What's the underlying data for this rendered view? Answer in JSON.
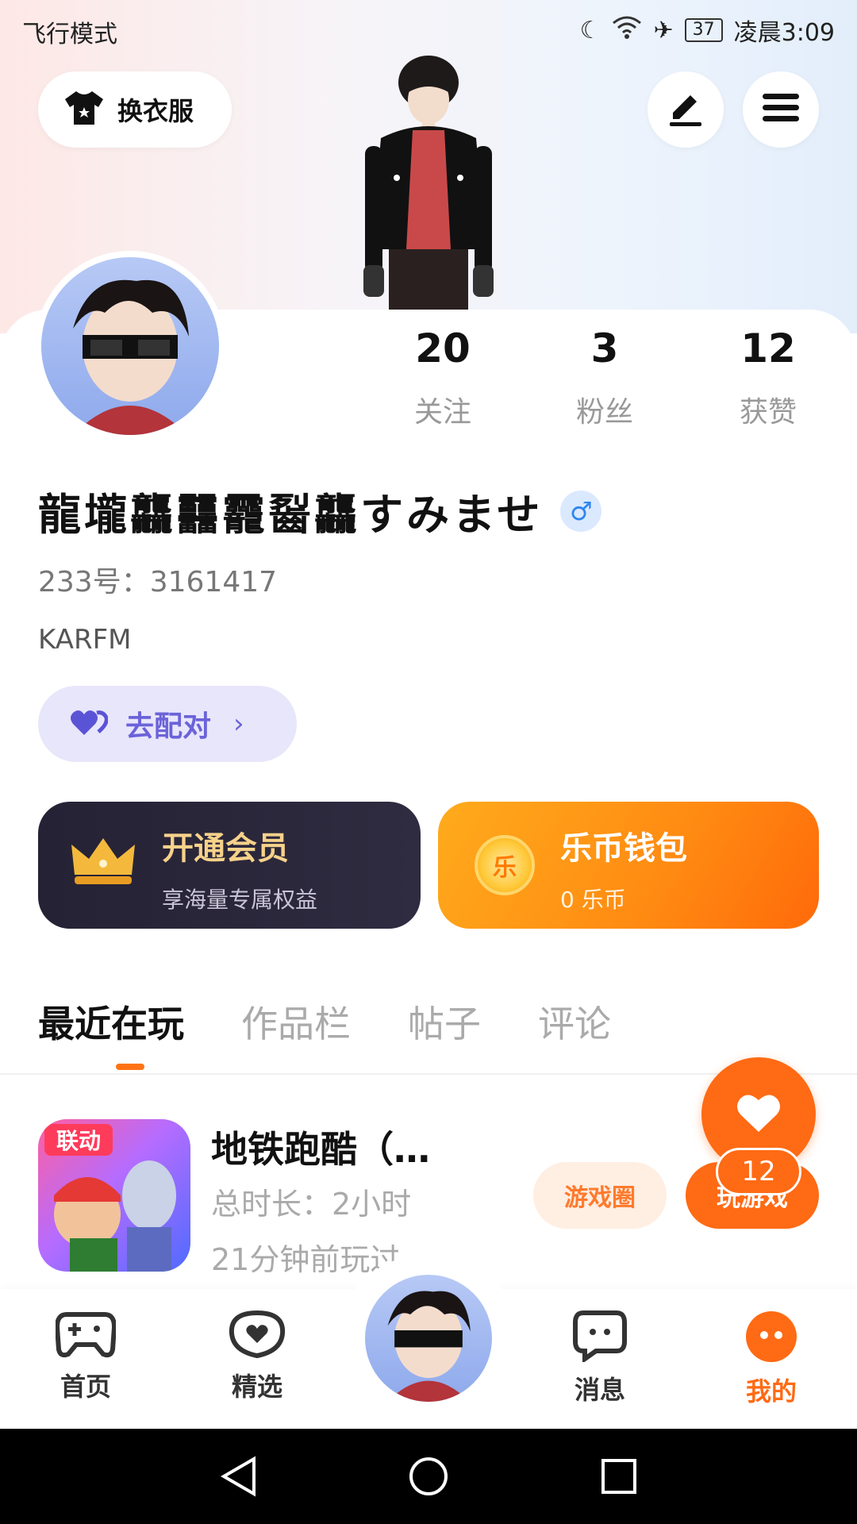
{
  "status_bar": {
    "left_text": "飞行模式",
    "battery": "37",
    "time": "凌晨3:09"
  },
  "header": {
    "outfit_label": "换衣服"
  },
  "stats": [
    {
      "value": "20",
      "label": "关注"
    },
    {
      "value": "3",
      "label": "粉丝"
    },
    {
      "value": "12",
      "label": "获赞"
    }
  ],
  "profile": {
    "name": "龍壠龘䨻龗䶛龘すみませ",
    "gender_symbol": "♂",
    "uid": "233号：3161417",
    "bio": "KARFM"
  },
  "match_button": {
    "label": "去配对"
  },
  "vip_card": {
    "title": "开通会员",
    "subtitle": "享海量专属权益"
  },
  "wallet_card": {
    "title": "乐币钱包",
    "subtitle": "0 乐币",
    "coin_glyph": "乐"
  },
  "tabs": [
    "最近在玩",
    "作品栏",
    "帖子",
    "评论"
  ],
  "game": {
    "title": "地铁跑酷（…",
    "duration": "总时长：2小时",
    "recent": "21分钟前玩过",
    "icon_badge": "联动",
    "circle_label": "游戏圈",
    "play_label": "玩游戏",
    "likes": "12"
  },
  "nav": [
    {
      "label": "首页",
      "icon": "gamepad-icon"
    },
    {
      "label": "精选",
      "icon": "heart-chat-icon"
    },
    {
      "label": "消息",
      "icon": "message-icon"
    },
    {
      "label": "我的",
      "icon": "profile-face-icon"
    }
  ],
  "colors": {
    "accent": "#ff6a14",
    "match": "#6b63d9",
    "vip_gold": "#f6d28a"
  }
}
